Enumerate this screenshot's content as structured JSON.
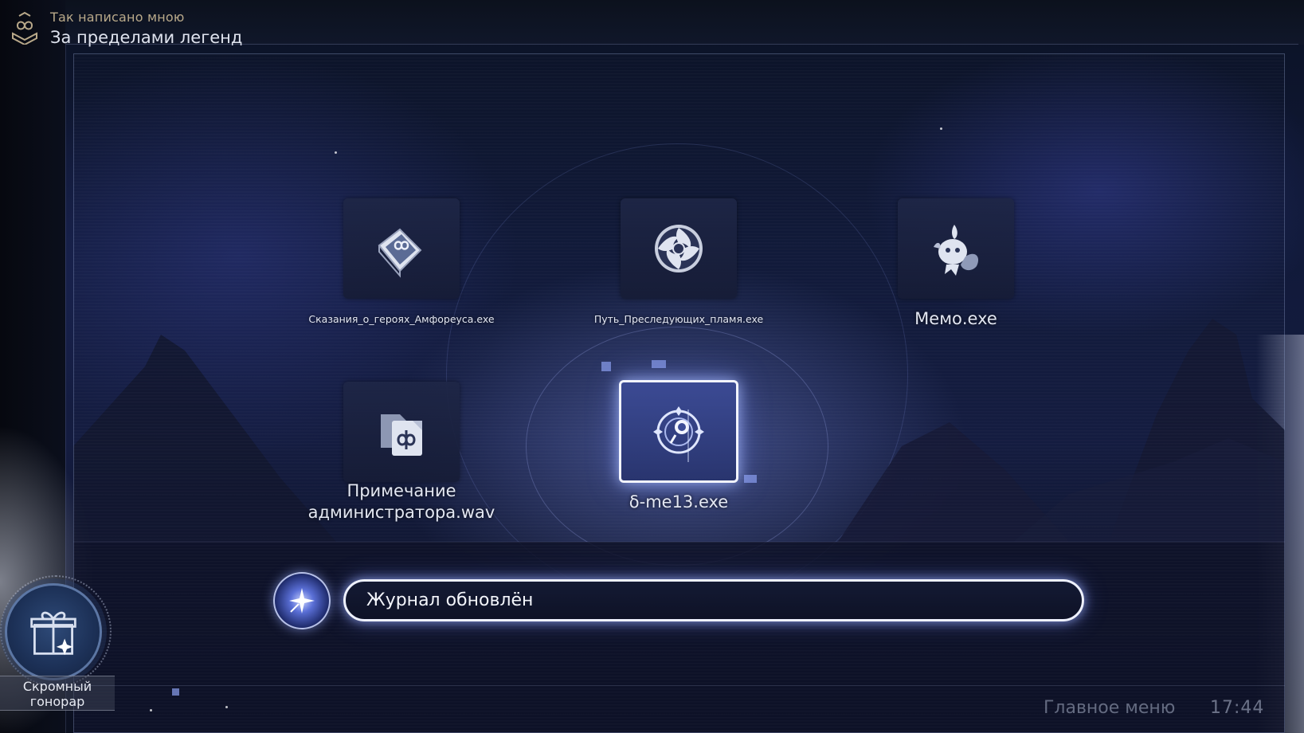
{
  "header": {
    "subtitle": "Так написано мною",
    "title": "За пределами легенд",
    "icon": "book-infinity-icon"
  },
  "apps": [
    {
      "label": "Сказания_о_героях_Амфореуса.exe",
      "icon": "storybook-icon"
    },
    {
      "label": "Путь_Преследующих_пламя.exe",
      "icon": "flame-swirl-icon"
    },
    {
      "label": "Мемо.exe",
      "icon": "memo-creature-icon"
    },
    {
      "label": "Примечание администратора.wav",
      "icon": "document-files-icon"
    },
    {
      "label": "δ-me13.exe",
      "icon": "delta-compass-icon",
      "selected": true
    }
  ],
  "notification": {
    "text": "Журнал обновлён",
    "icon": "sparkle-star-icon"
  },
  "reward": {
    "label": "Скромный гонорар",
    "icon": "gift-icon"
  },
  "footer": {
    "main_menu": "Главное меню",
    "clock": "17:44"
  },
  "colors": {
    "accent_glow": "#a8b8ff",
    "header_subtitle": "#b9a98a",
    "background": "#111a3a"
  }
}
